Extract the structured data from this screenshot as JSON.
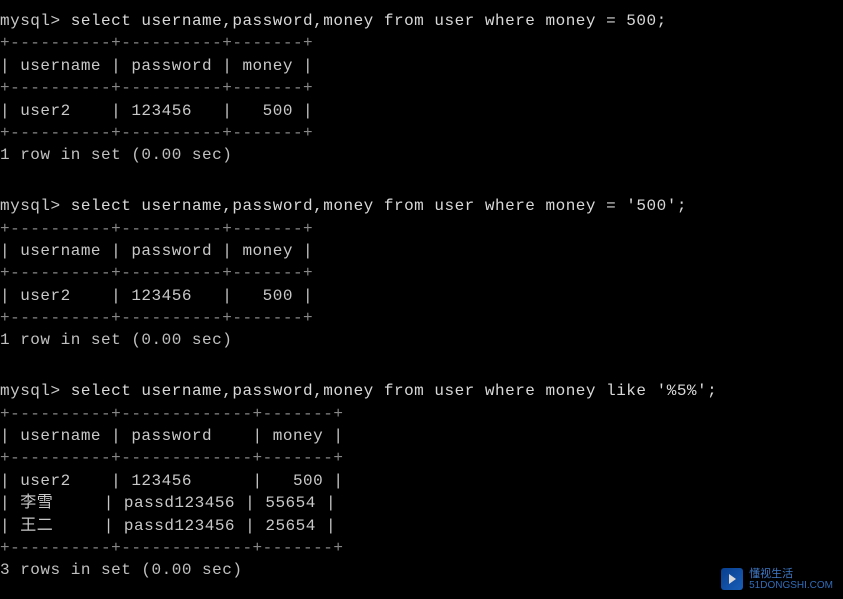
{
  "queries": [
    {
      "prompt": "mysql> ",
      "sql": "select username,password,money from user where money = 500;",
      "border_top": "+----------+----------+-------+",
      "header": "| username | password | money |",
      "border_mid": "+----------+----------+-------+",
      "rows": [
        "| user2    | 123456   |   500 |"
      ],
      "border_bot": "+----------+----------+-------+",
      "result": "1 row in set (0.00 sec)"
    },
    {
      "prompt": "mysql> ",
      "sql": "select username,password,money from user where money = '500';",
      "border_top": "+----------+----------+-------+",
      "header": "| username | password | money |",
      "border_mid": "+----------+----------+-------+",
      "rows": [
        "| user2    | 123456   |   500 |"
      ],
      "border_bot": "+----------+----------+-------+",
      "result": "1 row in set (0.00 sec)"
    },
    {
      "prompt": "mysql> ",
      "sql": "select username,password,money from user where money like '%5%';",
      "border_top": "+----------+-------------+-------+",
      "header": "| username | password    | money |",
      "border_mid": "+----------+-------------+-------+",
      "rows": [
        "| user2    | 123456      |   500 |",
        "| 李雪     | passd123456 | 55654 |",
        "| 王二     | passd123456 | 25654 |"
      ],
      "border_bot": "+----------+-------------+-------+",
      "result": "3 rows in set (0.00 sec)"
    }
  ],
  "watermark": {
    "brand_cn": "懂视生活",
    "brand_url": "51DONGSHI.COM"
  }
}
